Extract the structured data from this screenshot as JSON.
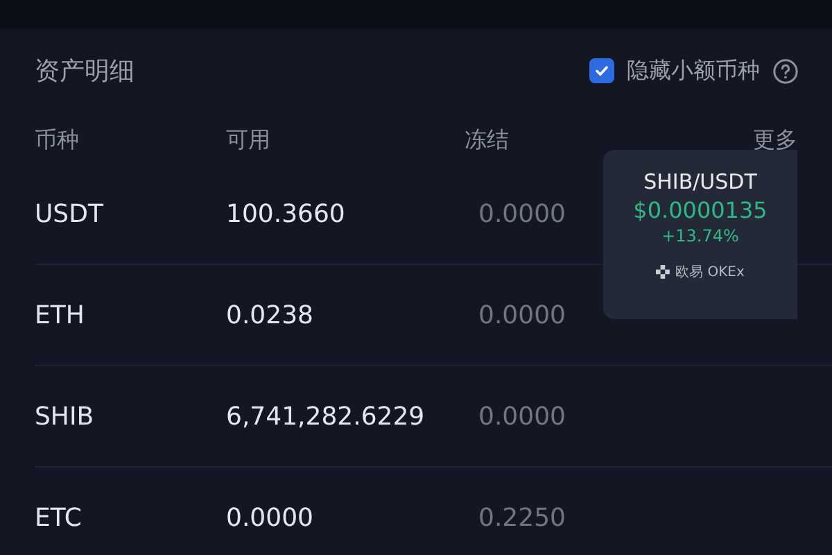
{
  "section_title": "资产明细",
  "hide_small": {
    "label": "隐藏小额币种",
    "checked": true
  },
  "table": {
    "columns": [
      "币种",
      "可用",
      "冻结",
      "更多"
    ],
    "rows": [
      {
        "coin": "USDT",
        "available": "100.3660",
        "frozen": "0.0000"
      },
      {
        "coin": "ETH",
        "available": "0.0238",
        "frozen": "0.0000"
      },
      {
        "coin": "SHIB",
        "available": "6,741,282.6229",
        "frozen": "0.0000"
      },
      {
        "coin": "ETC",
        "available": "0.0000",
        "frozen": "0.2250"
      }
    ]
  },
  "ticker_card": {
    "pair": "SHIB/USDT",
    "price": "$0.0000135",
    "change": "+13.74%",
    "brand": "欧易 OKEx"
  }
}
